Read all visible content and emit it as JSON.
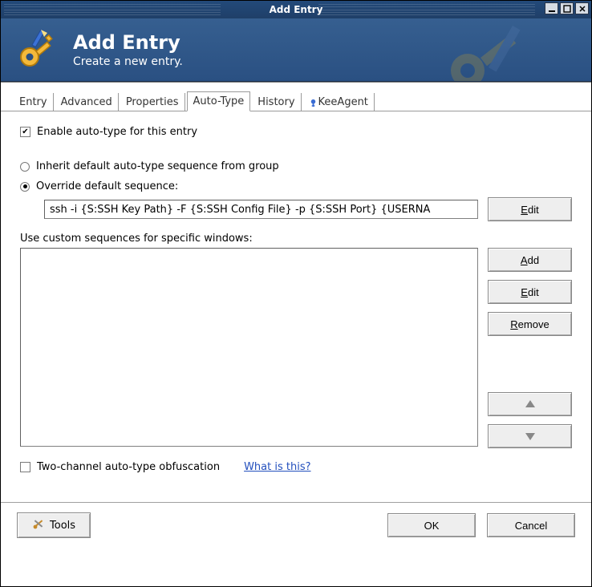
{
  "window": {
    "title": "Add Entry"
  },
  "header": {
    "title": "Add Entry",
    "subtitle": "Create a new entry."
  },
  "tabs": {
    "entry": "Entry",
    "advanced": "Advanced",
    "properties": "Properties",
    "autotype": "Auto-Type",
    "history": "History",
    "keeagent": "KeeAgent"
  },
  "autotype": {
    "enable_label": "Enable auto-type for this entry",
    "inherit_label": "Inherit default auto-type sequence from group",
    "override_label": "Override default sequence:",
    "sequence_value": "ssh -i {S:SSH Key Path} -F {S:SSH Config File} -p {S:SSH Port} {USERNA",
    "buttons": {
      "edit_main": "Edit",
      "add": "Add",
      "edit": "Edit",
      "remove": "Remove"
    },
    "custom_label": "Use custom sequences for specific windows:",
    "obfuscation_label": "Two-channel auto-type obfuscation",
    "whatis_label": "What is this?"
  },
  "footer": {
    "tools": "Tools",
    "ok": "OK",
    "cancel": "Cancel"
  }
}
